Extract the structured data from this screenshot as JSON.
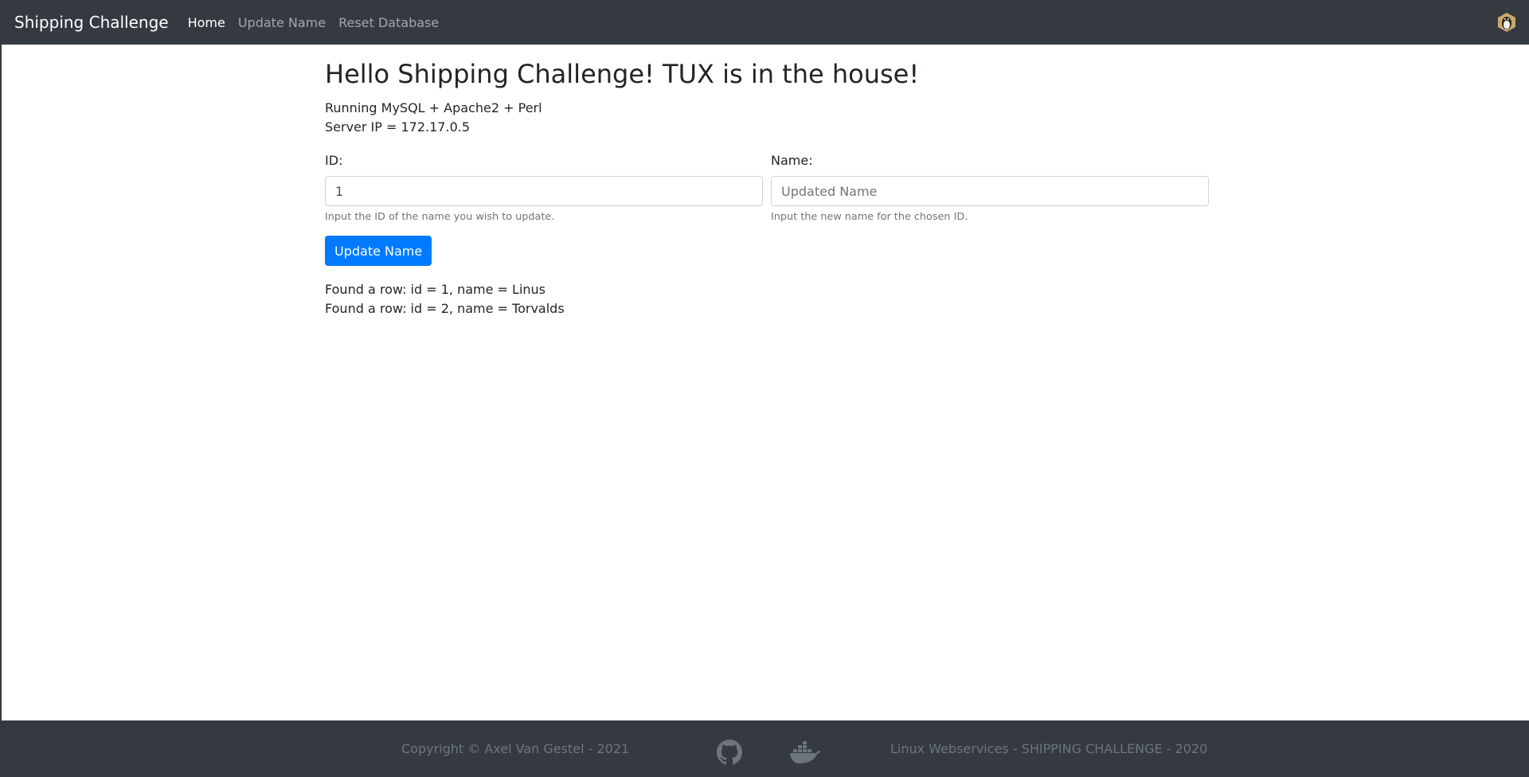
{
  "navbar": {
    "brand": "Shipping Challenge",
    "links": [
      {
        "label": "Home",
        "active": true
      },
      {
        "label": "Update Name",
        "active": false
      },
      {
        "label": "Reset Database",
        "active": false
      }
    ],
    "avatar_icon": "tux-icon"
  },
  "main": {
    "title": "Hello Shipping Challenge! TUX is in the house!",
    "stack_line": "Running MySQL + Apache2 + Perl",
    "server_ip_line": "Server IP = 172.17.0.5",
    "form": {
      "id_label": "ID:",
      "id_value": "1",
      "id_help": "Input the ID of the name you wish to update.",
      "name_label": "Name:",
      "name_placeholder": "Updated Name",
      "name_help": "Input the new name for the chosen ID.",
      "submit_label": "Update Name"
    },
    "rows": [
      "Found a row: id = 1, name = Linus",
      "Found a row: id = 2, name = Torvalds"
    ]
  },
  "footer": {
    "copyright": "Copyright © Axel Van Gestel - 2021",
    "right_text": "Linux Webservices - SHIPPING CHALLENGE - 2020",
    "icons": [
      "github-icon",
      "docker-icon"
    ]
  },
  "colors": {
    "navbar_bg": "#343a40",
    "primary": "#007bff",
    "muted": "#6c757d"
  }
}
